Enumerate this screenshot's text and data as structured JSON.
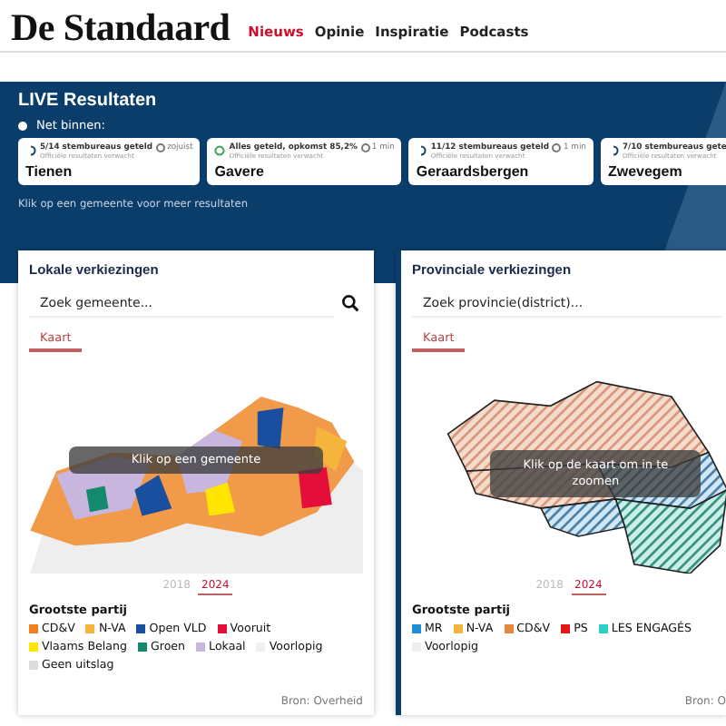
{
  "header": {
    "logo": "De Standaard",
    "nav": [
      {
        "label": "Nieuws",
        "selected": true
      },
      {
        "label": "Opinie",
        "selected": false
      },
      {
        "label": "Inspiratie",
        "selected": false
      },
      {
        "label": "Podcasts",
        "selected": false
      }
    ]
  },
  "live": {
    "title": "LIVE Resultaten",
    "incoming": "Net binnen:",
    "cards": [
      {
        "kind": "counting",
        "status": "5/14 stembureaus geteld",
        "time": "zojuist",
        "note": "Officiële resultaten verwacht",
        "name": "Tienen"
      },
      {
        "kind": "done",
        "status": "Alles geteld, opkomst 85,2%",
        "time": "1 min",
        "note": "Officiële resultaten verwacht",
        "name": "Gavere"
      },
      {
        "kind": "counting",
        "status": "11/12 stembureaus geteld",
        "time": "1 min",
        "note": "Officiële resultaten verwacht",
        "name": "Geraardsbergen"
      },
      {
        "kind": "counting",
        "status": "7/10 stembureaus gete",
        "note": "Officiële resultaten verwacht",
        "name": "Zwevegem"
      }
    ],
    "hint": "Klik op een gemeente voor meer resultaten"
  },
  "panels": [
    {
      "kind": "local",
      "title": "Lokale verkiezingen",
      "search": {
        "placeholder": "Zoek gemeente..."
      },
      "tabs": [
        {
          "label": "Kaart",
          "selected": true
        }
      ],
      "map_overlay": "Klik op een gemeente",
      "years": [
        {
          "label": "2018",
          "selected": false
        },
        {
          "label": "2024",
          "selected": true
        }
      ],
      "legend_title": "Grootste partij",
      "legend": [
        {
          "label": "CD&V",
          "color": "#f07f22"
        },
        {
          "label": "N-VA",
          "color": "#f5b53c"
        },
        {
          "label": "Open VLD",
          "color": "#1a4fa0"
        },
        {
          "label": "Vooruit",
          "color": "#e30e39"
        },
        {
          "label": "Vlaams Belang",
          "color": "#ffe500"
        },
        {
          "label": "Groen",
          "color": "#138a6e"
        },
        {
          "label": "Lokaal",
          "color": "#c9b6de"
        },
        {
          "label": "Voorlopig",
          "color": "#f0f0f0"
        },
        {
          "label": "Geen uitslag",
          "color": "#dcdcdc"
        }
      ],
      "source": "Bron: Overheid"
    },
    {
      "kind": "province",
      "title": "Provinciale verkiezingen",
      "search": {
        "placeholder": "Zoek provincie(district)..."
      },
      "tabs": [
        {
          "label": "Kaart",
          "selected": true
        }
      ],
      "map_overlay": "Klik op de kaart om in te zoomen",
      "years": [
        {
          "label": "2018",
          "selected": false
        },
        {
          "label": "2024",
          "selected": true
        }
      ],
      "legend_title": "Grootste partij",
      "legend": [
        {
          "label": "MR",
          "color": "#1e8fd6"
        },
        {
          "label": "N-VA",
          "color": "#f5b53c"
        },
        {
          "label": "CD&V",
          "color": "#e5873f"
        },
        {
          "label": "PS",
          "color": "#e51616"
        },
        {
          "label": "LES ENGAGÉS",
          "color": "#2ad0c8"
        },
        {
          "label": "Voorlopig",
          "color": "#eeeeee"
        }
      ],
      "source": "Bron: O"
    }
  ]
}
